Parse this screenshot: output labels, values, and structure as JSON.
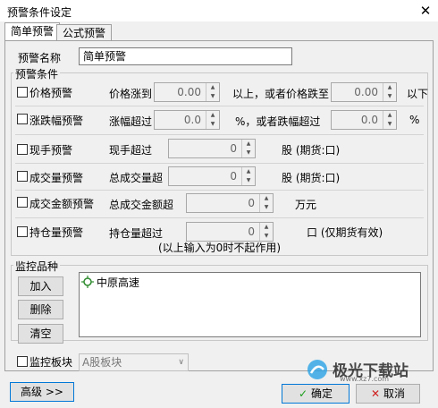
{
  "window": {
    "title": "预警条件设定",
    "close_glyph": "✕"
  },
  "tabs": [
    {
      "label": "简单预警"
    },
    {
      "label": "公式预警"
    }
  ],
  "name_field": {
    "label": "预警名称",
    "value": "简单预警"
  },
  "conditions": {
    "legend": "预警条件",
    "price": {
      "label": "价格预警",
      "text1": "价格涨到",
      "value1": "0.00",
      "text2": "以上，或者价格跌至",
      "value2": "0.00",
      "text3": "以下"
    },
    "change": {
      "label": "涨跌幅预警",
      "text1": "涨幅超过",
      "value1": "0.0",
      "text2": "%，或者跌幅超过",
      "value2": "0.0",
      "text3": "%"
    },
    "volume_now": {
      "label": "现手预警",
      "text1": "现手超过",
      "value1": "0",
      "text2": "股  (期货:口)"
    },
    "volume_total": {
      "label": "成交量预警",
      "text1": "总成交量超",
      "value1": "0",
      "text2": "股  (期货:口)"
    },
    "amount": {
      "label": "成交金额预警",
      "text1": "总成交金额超",
      "value1": "0",
      "text2": "万元"
    },
    "open_interest": {
      "label": "持仓量预警",
      "text1": "持仓量超过",
      "value1": "0",
      "text2": "口  (仅期货有效)"
    },
    "note": "(以上输入为0时不起作用)"
  },
  "monitor": {
    "legend": "监控品种",
    "buttons": {
      "add": "加入",
      "delete": "删除",
      "clear": "清空"
    },
    "items": [
      {
        "name": "中原高速"
      }
    ],
    "block_label": "监控板块",
    "block_value": "A股板块"
  },
  "footer": {
    "advanced": "高级 >>",
    "ok": "确定",
    "cancel": "取消"
  },
  "watermark": {
    "text": "极光下载站",
    "url": "www.xz7.com"
  },
  "colors": {
    "ok_check": "#1a9e1a",
    "cancel_x": "#d02020",
    "item_icon": "#2e8b2e"
  }
}
